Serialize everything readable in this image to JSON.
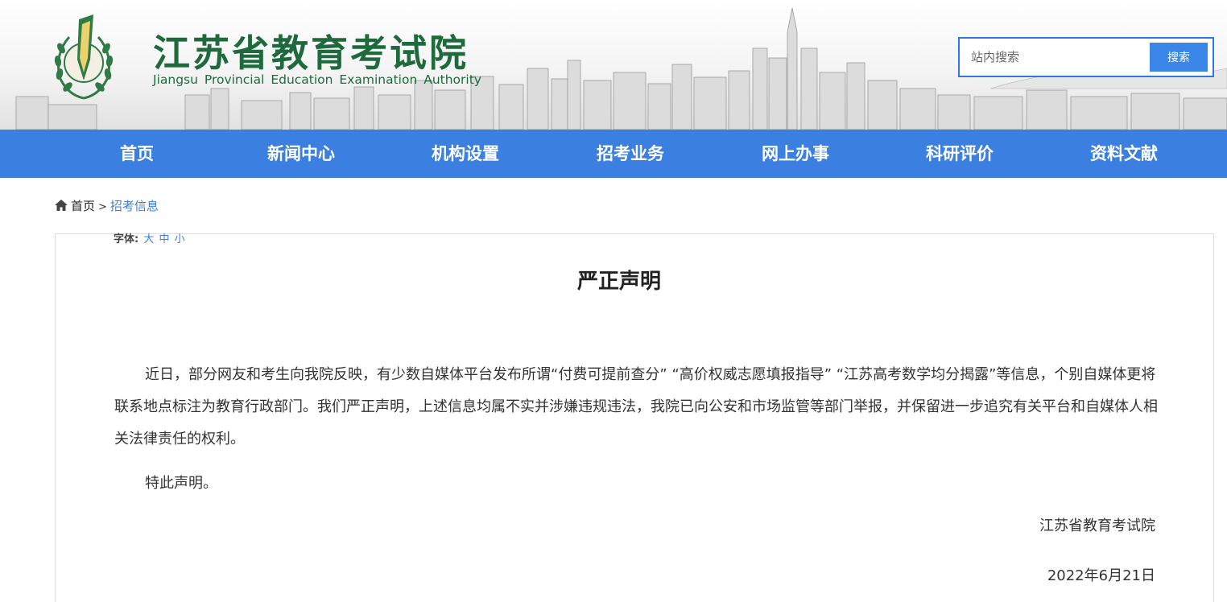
{
  "header": {
    "org_name_cn": "江苏省教育考试院",
    "org_name_en": "Jiangsu Provincial Education Examination Authority",
    "logo_icon": "laurel-emblem-icon",
    "search": {
      "placeholder": "站内搜索",
      "button_label": "搜索"
    }
  },
  "nav": {
    "items": [
      {
        "label": "首页"
      },
      {
        "label": "新闻中心"
      },
      {
        "label": "机构设置"
      },
      {
        "label": "招考业务"
      },
      {
        "label": "网上办事"
      },
      {
        "label": "科研评价"
      },
      {
        "label": "资料文献"
      }
    ]
  },
  "breadcrumb": {
    "icon": "home-icon",
    "home": "首页",
    "separator": ">",
    "current": "招考信息"
  },
  "article": {
    "font_size_label": "字体:",
    "font_size_options": [
      "大",
      "中",
      "小"
    ],
    "title": "严正声明",
    "paragraphs": [
      "近日，部分网友和考生向我院反映，有少数自媒体平台发布所谓“付费可提前查分” “高价权威志愿填报指导” “江苏高考数学均分揭露”等信息，个别自媒体更将联系地点标注为教育行政部门。我们严正声明，上述信息均属不实并涉嫌违规违法，我院已向公安和市场监管等部门举报，并保留进一步追究有关平台和自媒体人相关法律责任的权利。",
      "特此声明。"
    ],
    "signature": "江苏省教育考试院",
    "date": "2022年6月21日"
  },
  "colors": {
    "nav_bg": "#3b7fe0",
    "brand_green": "#1f6a3c",
    "link_blue": "#3b7fe0"
  }
}
